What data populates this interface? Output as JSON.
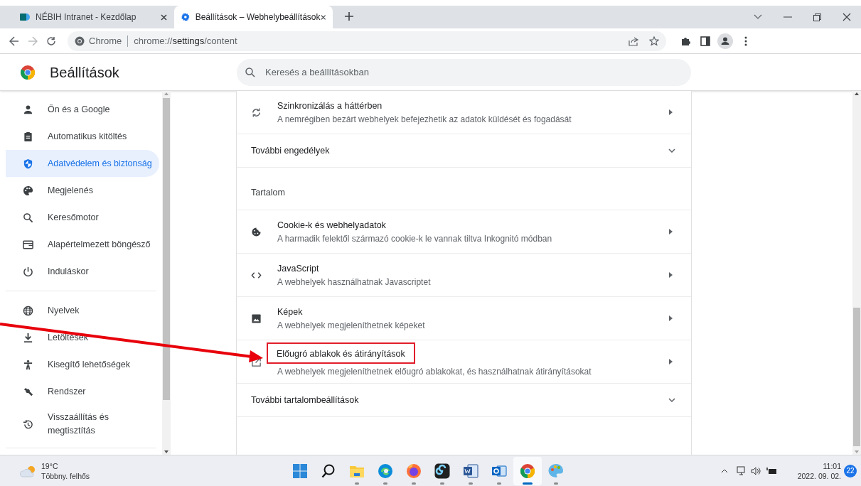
{
  "tabs": [
    {
      "title": "NÉBIH Intranet - Kezdőlap",
      "selected": false
    },
    {
      "title": "Beállítások – Webhelybeállítások",
      "selected": true
    }
  ],
  "address": {
    "site_label": "Chrome",
    "url": "chrome://**settings**/content"
  },
  "header": {
    "title": "Beállítások",
    "search_placeholder": "Keresés a beállításokban"
  },
  "sidebar": {
    "groups": [
      [
        {
          "label": "Ön és a Google",
          "selected": false
        },
        {
          "label": "Automatikus kitöltés",
          "selected": false
        },
        {
          "label": "Adatvédelem és biztonság",
          "selected": true
        },
        {
          "label": "Megjelenés",
          "selected": false
        },
        {
          "label": "Keresőmotor",
          "selected": false
        },
        {
          "label": "Alapértelmezett böngésző",
          "selected": false
        },
        {
          "label": "Induláskor",
          "selected": false
        }
      ],
      [
        {
          "label": "Nyelvek",
          "selected": false
        },
        {
          "label": "Letöltések",
          "selected": false
        },
        {
          "label": "Kisegítő lehetőségek",
          "selected": false
        },
        {
          "label": "Rendszer",
          "selected": false
        },
        {
          "label": "Visszaállítás és megtisztítás",
          "selected": false
        }
      ]
    ]
  },
  "content": [
    {
      "kind": "link",
      "title": "Szinkronizálás a háttérben",
      "subtitle": "A nemrégiben bezárt webhelyek befejezhetik az adatok küldését és fogadását",
      "highlighted": false
    },
    {
      "kind": "expand",
      "title": "További engedélyek"
    },
    {
      "kind": "heading",
      "title": "Tartalom"
    },
    {
      "kind": "link",
      "title": "Cookie-k és webhelyadatok",
      "subtitle": "A harmadik felektől származó cookie-k le vannak tiltva Inkognitó módban",
      "highlighted": false
    },
    {
      "kind": "link",
      "title": "JavaScript",
      "subtitle": "A webhelyek használhatnak Javascriptet",
      "highlighted": false
    },
    {
      "kind": "link",
      "title": "Képek",
      "subtitle": "A webhelyek megjeleníthetnek képeket",
      "highlighted": false
    },
    {
      "kind": "link",
      "title": "Előugró ablakok és átirányítások",
      "subtitle": "A webhelyek megjeleníthetnek előugró ablakokat, és használhatnak átirányításokat",
      "highlighted": true
    },
    {
      "kind": "expand",
      "title": "További tartalombeállítások"
    }
  ],
  "taskbar": {
    "weather": {
      "temperature": "19°C",
      "condition": "Többny. felhős"
    },
    "apps": [
      {
        "running": false,
        "selected": false
      },
      {
        "running": false,
        "selected": false
      },
      {
        "running": true,
        "selected": false
      },
      {
        "running": true,
        "selected": false
      },
      {
        "running": true,
        "selected": false
      },
      {
        "running": true,
        "selected": false
      },
      {
        "running": true,
        "selected": false
      },
      {
        "running": true,
        "selected": false
      },
      {
        "running": true,
        "selected": true
      },
      {
        "running": true,
        "selected": false
      }
    ],
    "time": "11:01",
    "date": "2022. 09. 02.",
    "notifications": "22"
  }
}
